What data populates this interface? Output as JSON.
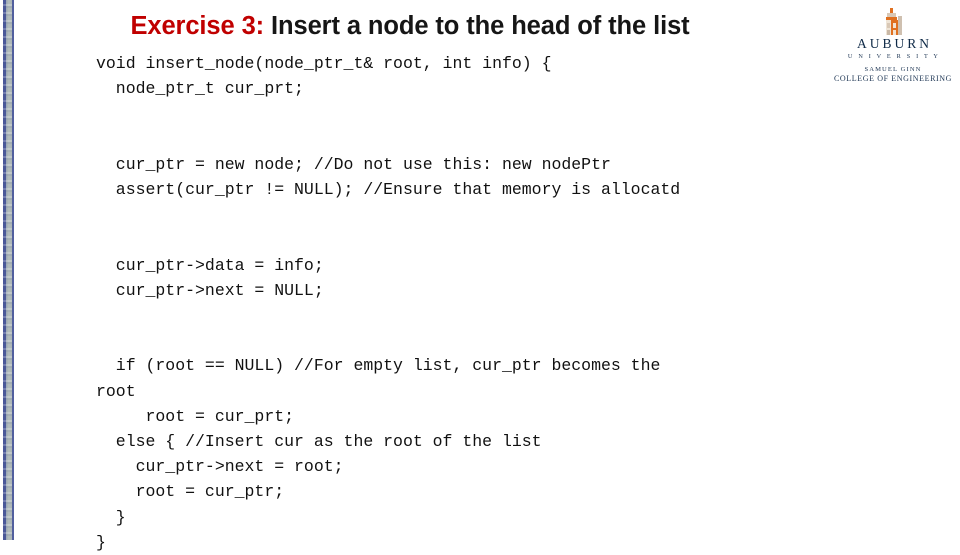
{
  "slide": {
    "title": {
      "accent_text": "Exercise 3:",
      "rest_text": " Insert a node to the head of the list",
      "accent_color": "#c00000",
      "text_color": "#161616"
    }
  },
  "logo": {
    "name": "auburn-university-samuel-ginn-college-of-engineering",
    "wordmark": "AUBURN",
    "sub_university": "U N I V E R S I T Y",
    "sub_college_line1": "SAMUEL GINN",
    "sub_college_line2": "COLLEGE OF ENGINEERING",
    "mark_color": "#e07020",
    "text_color": "#1d3553"
  },
  "decor": {
    "left_stripe": {
      "border_color": "#4a5899",
      "band_color": "#aab5b6"
    }
  },
  "code": {
    "language": "cpp",
    "lines": [
      "void insert_node(node_ptr_t& root, int info) {",
      "  node_ptr_t cur_prt;",
      "",
      "",
      "  cur_ptr = new node; //Do not use this: new nodePtr",
      "  assert(cur_ptr != NULL); //Ensure that memory is allocatd",
      "",
      "",
      "  cur_ptr->data = info;",
      "  cur_ptr->next = NULL;",
      "",
      "",
      "  if (root == NULL) //For empty list, cur_ptr becomes the",
      "root",
      "     root = cur_prt;",
      "  else { //Insert cur as the root of the list",
      "    cur_ptr->next = root;",
      "    root = cur_ptr;",
      "  }",
      "}"
    ]
  }
}
